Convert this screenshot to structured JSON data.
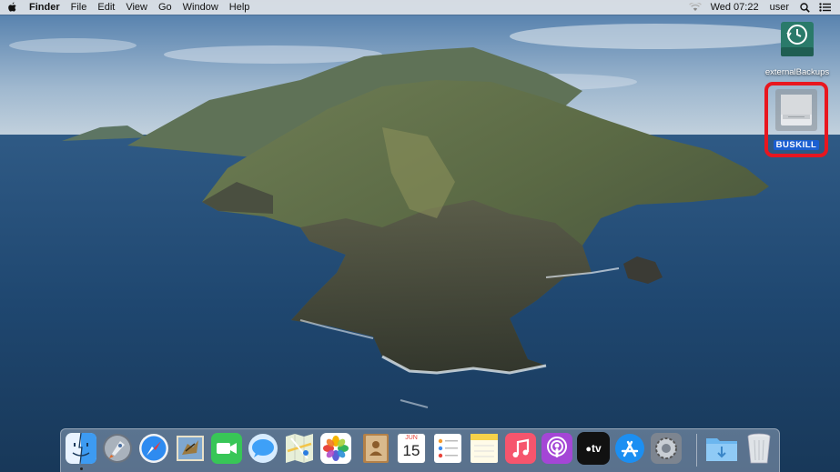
{
  "menubar": {
    "apple_icon": "apple-icon",
    "app_name": "Finder",
    "menus": [
      "File",
      "Edit",
      "View",
      "Go",
      "Window",
      "Help"
    ],
    "clock": "Wed 07:22",
    "user": "user",
    "status_icons": [
      "wifi-icon",
      "spotlight-search-icon",
      "control-center-icon"
    ]
  },
  "desktop": {
    "icons": [
      {
        "label": "externalBackups",
        "icon": "time-machine-disk-icon",
        "selected": false
      },
      {
        "label": "BUSKILL",
        "icon": "external-drive-icon",
        "selected": true
      }
    ],
    "highlight_color": "#e8161f"
  },
  "dock": {
    "apps": [
      {
        "name": "Finder",
        "icon": "finder-icon",
        "running": true
      },
      {
        "name": "Launchpad",
        "icon": "launchpad-icon"
      },
      {
        "name": "Safari",
        "icon": "safari-icon"
      },
      {
        "name": "Mail",
        "icon": "mail-icon"
      },
      {
        "name": "FaceTime",
        "icon": "facetime-icon"
      },
      {
        "name": "Messages",
        "icon": "messages-icon"
      },
      {
        "name": "Maps",
        "icon": "maps-icon"
      },
      {
        "name": "Photos",
        "icon": "photos-icon"
      },
      {
        "name": "Contacts",
        "icon": "contacts-icon"
      },
      {
        "name": "Calendar",
        "icon": "calendar-icon",
        "month": "JUN",
        "day": "15"
      },
      {
        "name": "Reminders",
        "icon": "reminders-icon"
      },
      {
        "name": "Notes",
        "icon": "notes-icon"
      },
      {
        "name": "Music",
        "icon": "music-icon"
      },
      {
        "name": "Podcasts",
        "icon": "podcasts-icon"
      },
      {
        "name": "TV",
        "icon": "tv-icon",
        "text": "tv"
      },
      {
        "name": "App Store",
        "icon": "app-store-icon"
      },
      {
        "name": "System Preferences",
        "icon": "system-preferences-icon"
      },
      {
        "name": "Downloads",
        "icon": "downloads-folder-icon"
      },
      {
        "name": "Trash",
        "icon": "trash-icon"
      }
    ]
  }
}
